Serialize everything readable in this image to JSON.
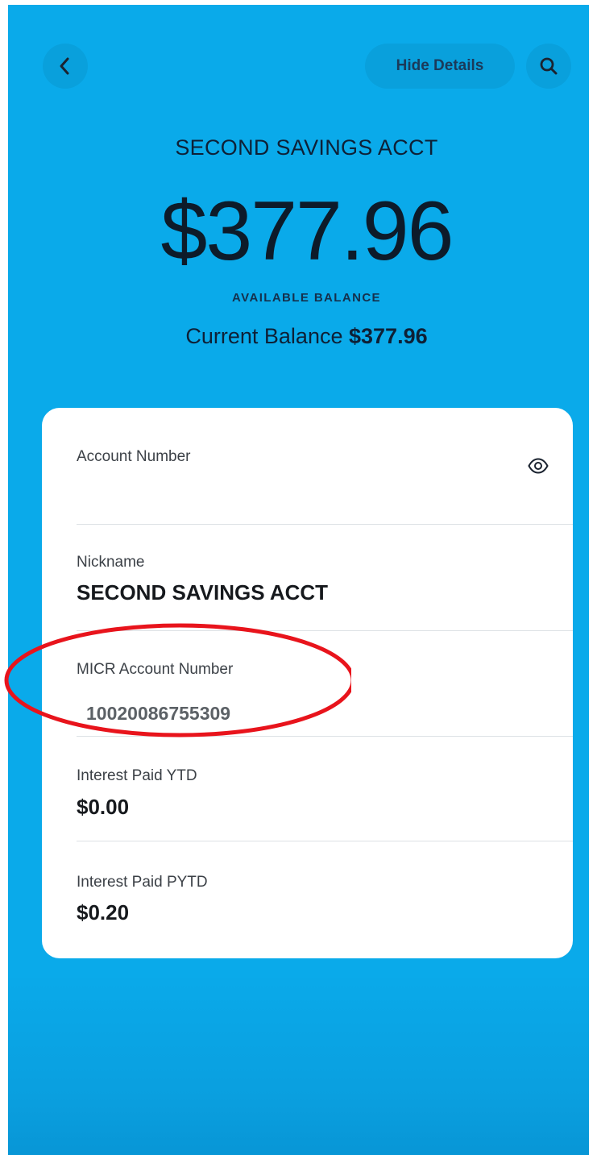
{
  "header": {
    "back_icon": "chevron-left-icon",
    "hide_details_label": "Hide Details",
    "search_icon": "search-icon"
  },
  "account": {
    "title": "SECOND SAVINGS ACCT",
    "available_balance": "$377.96",
    "available_label": "AVAILABLE BALANCE",
    "current_balance_label": "Current Balance",
    "current_balance_value": "$377.96"
  },
  "details": {
    "account_number_label": "Account Number",
    "reveal_icon": "eye-icon",
    "nickname_label": "Nickname",
    "nickname_value": "SECOND SAVINGS ACCT",
    "micr_label": "MICR Account Number",
    "micr_value": "10020086755309",
    "interest_ytd_label": "Interest Paid YTD",
    "interest_ytd_value": "$0.00",
    "interest_pytd_label": "Interest Paid PYTD",
    "interest_pytd_value": "$0.20"
  },
  "colors": {
    "background": "#0aaaea",
    "annotation": "#e8141c",
    "card": "#ffffff"
  }
}
